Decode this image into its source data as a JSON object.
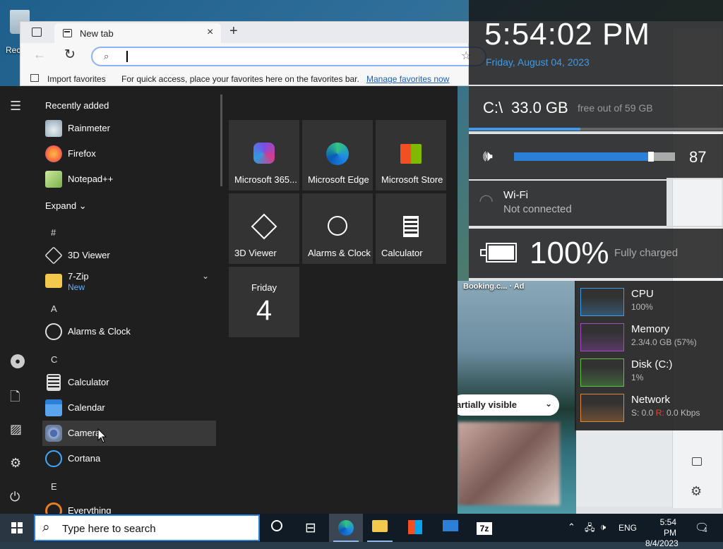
{
  "desktop": {
    "recycle_label": "Rec"
  },
  "browser": {
    "tab_title": "New tab",
    "tab_close": "×",
    "new_tab": "+",
    "back": "←",
    "refresh": "↻",
    "search_glyph": "⌕",
    "fav_star": "☆",
    "import_label": "Import favorites",
    "fav_hint": "For quick access, place your favorites here on the favorites bar.",
    "manage_link": "Manage favorites now"
  },
  "rainmeter": {
    "time": "5:54:02 PM",
    "date": "Friday, August 04, 2023",
    "disk_drive": "C:\\",
    "disk_free": "33.0 GB",
    "disk_rest": "free out of 59 GB",
    "disk_used_fraction": 0.44,
    "volume": "87",
    "volume_fraction": 0.87,
    "wifi_name": "Wi-Fi",
    "wifi_status": "Not connected",
    "battery_pct": "100%",
    "battery_status": "Fully charged",
    "resources": [
      {
        "name": "CPU",
        "value": "100%",
        "color": "#3e9be9"
      },
      {
        "name": "Memory",
        "value": "2.3/4.0 GB (57%)",
        "color": "#a64ac9"
      },
      {
        "name": "Disk (C:)",
        "value": "1%",
        "color": "#5fc24a"
      },
      {
        "name": "Network",
        "value": "S: 0.0 R: 0.0 Kbps",
        "color": "#e0873a"
      }
    ]
  },
  "webpage": {
    "ad_label": "Booking.c... · Ad",
    "partial_label": "artially visible"
  },
  "start_menu": {
    "recently_added": "Recently added",
    "recent_apps": [
      "Rainmeter",
      "Firefox",
      "Notepad++"
    ],
    "expand": "Expand",
    "letters": {
      "hash": "#",
      "A": "A",
      "C": "C",
      "E": "E"
    },
    "apps": {
      "viewer": "3D Viewer",
      "zip": "7-Zip",
      "zip_sub": "New",
      "alarms": "Alarms & Clock",
      "calculator": "Calculator",
      "calendar": "Calendar",
      "camera": "Camera",
      "cortana": "Cortana",
      "everything": "Everything"
    },
    "tiles": [
      {
        "label": "Microsoft 365...",
        "icon": "m365-icon"
      },
      {
        "label": "Microsoft Edge",
        "icon": "edge-icon"
      },
      {
        "label": "Microsoft Store",
        "icon": "store-icon"
      },
      {
        "label": "3D Viewer",
        "icon": "cube-icon"
      },
      {
        "label": "Alarms & Clock",
        "icon": "alarm-icon"
      },
      {
        "label": "Calculator",
        "icon": "calculator-icon"
      }
    ],
    "date_tile": {
      "day": "Friday",
      "num": "4"
    }
  },
  "taskbar": {
    "search_placeholder": "Type here to search",
    "lang": "ENG",
    "time": "5:54 PM",
    "date": "8/4/2023",
    "notif_count": "4"
  }
}
